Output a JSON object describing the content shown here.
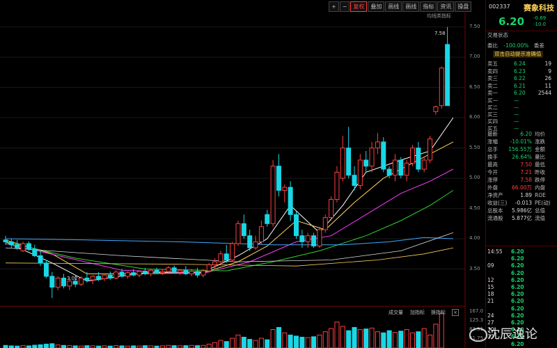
{
  "toolbar": {
    "items": [
      "+",
      "−",
      "复权",
      "叠加",
      "画线",
      "画线",
      "指标",
      "资讯",
      "操盘"
    ],
    "active_index": 2
  },
  "ma_label": "均线类指标",
  "price_axis": [
    "7.50",
    "7.00",
    "6.50",
    "6.00",
    "5.50",
    "5.00",
    "4.50",
    "4.00",
    "3.50"
  ],
  "volume_axis": [
    "167.0",
    "125.3",
    "83.51",
    "41.75"
  ],
  "high_label": "7.58",
  "low_label": "3.02",
  "volume_buttons": [
    "成交量",
    "加指标",
    "换指标"
  ],
  "stock": {
    "code": "002337",
    "name": "赛象科技",
    "price": "6.20",
    "change": "-0.69",
    "change_pct": "-10.0"
  },
  "section_title": "交易状态",
  "commission": {
    "label": "委比",
    "value": "-100.00%",
    "label2": "委差"
  },
  "tip": "双击自动提示准确值",
  "sell": [
    {
      "label": "卖五",
      "price": "6.24",
      "vol": "19"
    },
    {
      "label": "卖四",
      "price": "6.23",
      "vol": "9"
    },
    {
      "label": "卖三",
      "price": "6.22",
      "vol": "26"
    },
    {
      "label": "卖二",
      "price": "6.21",
      "vol": "11"
    },
    {
      "label": "卖一",
      "price": "6.20",
      "vol": "2544"
    }
  ],
  "buy": [
    {
      "label": "买一",
      "price": "—",
      "vol": ""
    },
    {
      "label": "买二",
      "price": "—",
      "vol": ""
    },
    {
      "label": "买三",
      "price": "—",
      "vol": ""
    },
    {
      "label": "买四",
      "price": "—",
      "vol": ""
    },
    {
      "label": "买五",
      "price": "—",
      "vol": ""
    }
  ],
  "quote": [
    {
      "l1": "最新",
      "v1": "6.20",
      "l2": "均价"
    },
    {
      "l1": "涨幅",
      "v1": "-10.01%",
      "l2": "涨跌"
    },
    {
      "l1": "总手",
      "v1": "156.55万",
      "l2": "金额"
    },
    {
      "l1": "换手",
      "v1": "26.64%",
      "l2": "量比"
    },
    {
      "l1": "最高",
      "v1": "7.50",
      "l2": "最低"
    },
    {
      "l1": "今开",
      "v1": "7.21",
      "l2": "昨收"
    },
    {
      "l1": "涨停",
      "v1": "7.58",
      "l2": "跌停"
    },
    {
      "l1": "外盘",
      "v1": "66.00万",
      "l2": "内盘"
    },
    {
      "l1": "净资产",
      "v1": "1.89",
      "l2": "ROE"
    },
    {
      "l1": "收益(三)",
      "v1": "-0.013",
      "l2": "PE(动)"
    },
    {
      "l1": "总股本",
      "v1": "5.986亿",
      "l2": "总值"
    },
    {
      "l1": "流通股",
      "v1": "5.877亿",
      "l2": "流值"
    }
  ],
  "ticks": [
    {
      "time": "14:55",
      "price": "6.20"
    },
    {
      "time": "",
      "price": "6.20"
    },
    {
      "time": "09",
      "price": "6.20"
    },
    {
      "time": "",
      "price": "6.20"
    },
    {
      "time": "12",
      "price": "6.20"
    },
    {
      "time": "15",
      "price": "6.20"
    },
    {
      "time": "18",
      "price": "6.20"
    },
    {
      "time": "21",
      "price": "6.20"
    },
    {
      "time": "",
      "price": "6.20"
    },
    {
      "time": "24",
      "price": "6.20"
    },
    {
      "time": "27",
      "price": "6.20"
    },
    {
      "time": "30",
      "price": "6.20"
    },
    {
      "time": "33",
      "price": "6.20"
    },
    {
      "time": "",
      "price": "6.20"
    }
  ],
  "watermark": "沈辰逸论",
  "colors": {
    "up": "#ff4040",
    "down": "#19d7e6",
    "bg": "#000000",
    "ma5": "#ffffff",
    "ma10": "#ffd35a",
    "ma20": "#ff3cff",
    "ma30": "#2fd32f",
    "ma60": "#3fa9ff"
  },
  "chart_data": {
    "type": "candlestick",
    "ylim": [
      3.0,
      7.6
    ],
    "candles": [
      {
        "o": 3.98,
        "h": 4.05,
        "l": 3.9,
        "c": 3.95
      },
      {
        "o": 3.95,
        "h": 4.0,
        "l": 3.85,
        "c": 3.9
      },
      {
        "o": 3.9,
        "h": 3.98,
        "l": 3.82,
        "c": 3.85
      },
      {
        "o": 3.8,
        "h": 3.95,
        "l": 3.78,
        "c": 3.92
      },
      {
        "o": 3.92,
        "h": 3.96,
        "l": 3.8,
        "c": 3.83
      },
      {
        "o": 3.83,
        "h": 3.9,
        "l": 3.7,
        "c": 3.72
      },
      {
        "o": 3.72,
        "h": 3.8,
        "l": 3.55,
        "c": 3.6
      },
      {
        "o": 3.6,
        "h": 3.65,
        "l": 3.35,
        "c": 3.38
      },
      {
        "o": 3.38,
        "h": 3.45,
        "l": 3.02,
        "c": 3.2
      },
      {
        "o": 3.2,
        "h": 3.38,
        "l": 3.15,
        "c": 3.35
      },
      {
        "o": 3.35,
        "h": 3.42,
        "l": 3.18,
        "c": 3.22
      },
      {
        "o": 3.22,
        "h": 3.35,
        "l": 3.15,
        "c": 3.3
      },
      {
        "o": 3.3,
        "h": 3.4,
        "l": 3.2,
        "c": 3.25
      },
      {
        "o": 3.25,
        "h": 3.38,
        "l": 3.22,
        "c": 3.35
      },
      {
        "o": 3.35,
        "h": 3.45,
        "l": 3.28,
        "c": 3.32
      },
      {
        "o": 3.32,
        "h": 3.4,
        "l": 3.25,
        "c": 3.38
      },
      {
        "o": 3.38,
        "h": 3.45,
        "l": 3.3,
        "c": 3.34
      },
      {
        "o": 3.34,
        "h": 3.42,
        "l": 3.3,
        "c": 3.4
      },
      {
        "o": 3.4,
        "h": 3.46,
        "l": 3.32,
        "c": 3.35
      },
      {
        "o": 3.35,
        "h": 3.48,
        "l": 3.33,
        "c": 3.45
      },
      {
        "o": 3.45,
        "h": 3.5,
        "l": 3.36,
        "c": 3.38
      },
      {
        "o": 3.38,
        "h": 3.46,
        "l": 3.34,
        "c": 3.44
      },
      {
        "o": 3.44,
        "h": 3.5,
        "l": 3.38,
        "c": 3.4
      },
      {
        "o": 3.4,
        "h": 3.48,
        "l": 3.36,
        "c": 3.46
      },
      {
        "o": 3.46,
        "h": 3.52,
        "l": 3.4,
        "c": 3.42
      },
      {
        "o": 3.42,
        "h": 3.5,
        "l": 3.38,
        "c": 3.48
      },
      {
        "o": 3.48,
        "h": 3.52,
        "l": 3.42,
        "c": 3.44
      },
      {
        "o": 3.44,
        "h": 3.5,
        "l": 3.4,
        "c": 3.46
      },
      {
        "o": 3.46,
        "h": 3.55,
        "l": 3.44,
        "c": 3.52
      },
      {
        "o": 3.52,
        "h": 3.56,
        "l": 3.42,
        "c": 3.45
      },
      {
        "o": 3.45,
        "h": 3.5,
        "l": 3.4,
        "c": 3.48
      },
      {
        "o": 3.48,
        "h": 3.55,
        "l": 3.4,
        "c": 3.42
      },
      {
        "o": 3.42,
        "h": 3.5,
        "l": 3.38,
        "c": 3.46
      },
      {
        "o": 3.46,
        "h": 3.52,
        "l": 3.36,
        "c": 3.4
      },
      {
        "o": 3.4,
        "h": 3.5,
        "l": 3.36,
        "c": 3.47
      },
      {
        "o": 3.47,
        "h": 3.6,
        "l": 3.44,
        "c": 3.57
      },
      {
        "o": 3.57,
        "h": 3.68,
        "l": 3.5,
        "c": 3.62
      },
      {
        "o": 3.62,
        "h": 3.8,
        "l": 3.58,
        "c": 3.75
      },
      {
        "o": 3.75,
        "h": 3.9,
        "l": 3.6,
        "c": 3.65
      },
      {
        "o": 3.65,
        "h": 3.95,
        "l": 3.62,
        "c": 3.92
      },
      {
        "o": 3.92,
        "h": 4.3,
        "l": 3.88,
        "c": 4.25
      },
      {
        "o": 4.25,
        "h": 4.4,
        "l": 4.0,
        "c": 4.05
      },
      {
        "o": 4.05,
        "h": 4.15,
        "l": 3.8,
        "c": 3.85
      },
      {
        "o": 3.85,
        "h": 4.05,
        "l": 3.82,
        "c": 3.95
      },
      {
        "o": 3.95,
        "h": 4.3,
        "l": 3.9,
        "c": 4.2
      },
      {
        "o": 4.4,
        "h": 4.48,
        "l": 4.2,
        "c": 4.25
      },
      {
        "o": 4.25,
        "h": 5.3,
        "l": 4.2,
        "c": 5.2
      },
      {
        "o": 5.2,
        "h": 5.4,
        "l": 4.7,
        "c": 4.8
      },
      {
        "o": 4.8,
        "h": 4.9,
        "l": 4.6,
        "c": 4.85
      },
      {
        "o": 4.85,
        "h": 4.95,
        "l": 4.3,
        "c": 4.4
      },
      {
        "o": 4.4,
        "h": 4.45,
        "l": 4.0,
        "c": 4.05
      },
      {
        "o": 4.05,
        "h": 4.15,
        "l": 3.85,
        "c": 3.95
      },
      {
        "o": 3.95,
        "h": 4.1,
        "l": 3.85,
        "c": 4.05
      },
      {
        "o": 4.05,
        "h": 4.1,
        "l": 3.85,
        "c": 3.88
      },
      {
        "o": 3.88,
        "h": 4.2,
        "l": 3.85,
        "c": 4.15
      },
      {
        "o": 4.15,
        "h": 4.4,
        "l": 4.1,
        "c": 4.35
      },
      {
        "o": 4.35,
        "h": 4.7,
        "l": 4.3,
        "c": 4.65
      },
      {
        "o": 4.65,
        "h": 5.2,
        "l": 4.6,
        "c": 5.1
      },
      {
        "o": 5.0,
        "h": 5.7,
        "l": 4.95,
        "c": 5.5
      },
      {
        "o": 5.5,
        "h": 5.85,
        "l": 5.0,
        "c": 5.05
      },
      {
        "o": 5.05,
        "h": 5.2,
        "l": 4.8,
        "c": 4.88
      },
      {
        "o": 4.88,
        "h": 5.4,
        "l": 4.82,
        "c": 5.3
      },
      {
        "o": 5.3,
        "h": 5.45,
        "l": 5.1,
        "c": 5.2
      },
      {
        "o": 5.2,
        "h": 5.6,
        "l": 5.1,
        "c": 5.5
      },
      {
        "o": 5.5,
        "h": 5.75,
        "l": 5.4,
        "c": 5.6
      },
      {
        "o": 5.6,
        "h": 5.68,
        "l": 5.1,
        "c": 5.15
      },
      {
        "o": 5.15,
        "h": 5.2,
        "l": 5.0,
        "c": 5.05
      },
      {
        "o": 5.05,
        "h": 5.4,
        "l": 4.95,
        "c": 5.3
      },
      {
        "o": 5.3,
        "h": 5.35,
        "l": 5.0,
        "c": 5.05
      },
      {
        "o": 5.05,
        "h": 5.3,
        "l": 4.95,
        "c": 5.25
      },
      {
        "o": 5.25,
        "h": 5.55,
        "l": 5.2,
        "c": 5.5
      },
      {
        "o": 5.5,
        "h": 5.6,
        "l": 5.1,
        "c": 5.15
      },
      {
        "o": 5.15,
        "h": 5.35,
        "l": 5.1,
        "c": 5.3
      },
      {
        "o": 5.3,
        "h": 5.7,
        "l": 5.25,
        "c": 5.65
      },
      {
        "o": 6.1,
        "h": 6.2,
        "l": 6.05,
        "c": 6.18
      },
      {
        "o": 6.2,
        "h": 6.85,
        "l": 6.15,
        "c": 6.82
      },
      {
        "o": 7.21,
        "h": 7.5,
        "l": 6.2,
        "c": 6.2
      }
    ],
    "volumes": [
      12,
      10,
      9,
      11,
      10,
      13,
      15,
      18,
      20,
      14,
      12,
      11,
      10,
      9,
      11,
      10,
      9,
      10,
      9,
      11,
      10,
      9,
      10,
      9,
      11,
      10,
      9,
      10,
      12,
      11,
      10,
      11,
      12,
      11,
      12,
      18,
      25,
      35,
      30,
      45,
      60,
      50,
      40,
      35,
      45,
      38,
      85,
      95,
      70,
      60,
      55,
      50,
      48,
      52,
      60,
      75,
      90,
      120,
      100,
      80,
      95,
      85,
      88,
      92,
      75,
      70,
      80,
      72,
      78,
      85,
      70,
      75,
      90,
      60,
      110,
      160
    ],
    "ma": {
      "ma5": [
        [
          0,
          3.95
        ],
        [
          8,
          3.6
        ],
        [
          14,
          3.3
        ],
        [
          24,
          3.44
        ],
        [
          34,
          3.45
        ],
        [
          40,
          3.72
        ],
        [
          45,
          4.0
        ],
        [
          49,
          4.55
        ],
        [
          54,
          4.1
        ],
        [
          58,
          4.55
        ],
        [
          62,
          5.1
        ],
        [
          68,
          5.3
        ],
        [
          73,
          5.45
        ],
        [
          77,
          6.0
        ]
      ],
      "ma10": [
        [
          0,
          3.98
        ],
        [
          8,
          3.75
        ],
        [
          14,
          3.42
        ],
        [
          24,
          3.42
        ],
        [
          34,
          3.44
        ],
        [
          40,
          3.62
        ],
        [
          45,
          3.88
        ],
        [
          50,
          4.3
        ],
        [
          55,
          4.15
        ],
        [
          60,
          4.6
        ],
        [
          65,
          5.0
        ],
        [
          70,
          5.25
        ],
        [
          77,
          5.6
        ]
      ],
      "ma20": [
        [
          0,
          3.92
        ],
        [
          10,
          3.7
        ],
        [
          20,
          3.48
        ],
        [
          34,
          3.43
        ],
        [
          42,
          3.62
        ],
        [
          50,
          3.95
        ],
        [
          56,
          4.05
        ],
        [
          62,
          4.4
        ],
        [
          68,
          4.75
        ],
        [
          73,
          4.95
        ],
        [
          77,
          5.15
        ]
      ],
      "ma30": [
        [
          0,
          3.95
        ],
        [
          12,
          3.68
        ],
        [
          24,
          3.5
        ],
        [
          38,
          3.47
        ],
        [
          46,
          3.62
        ],
        [
          54,
          3.8
        ],
        [
          62,
          4.05
        ],
        [
          68,
          4.3
        ],
        [
          73,
          4.55
        ],
        [
          77,
          4.8
        ]
      ],
      "ma60": [
        [
          0,
          4.0
        ],
        [
          14,
          3.98
        ],
        [
          30,
          3.95
        ],
        [
          46,
          3.9
        ],
        [
          58,
          3.9
        ],
        [
          66,
          3.95
        ],
        [
          72,
          4.02
        ],
        [
          77,
          4.0
        ]
      ],
      "ma120": [
        [
          0,
          3.85
        ],
        [
          20,
          3.72
        ],
        [
          40,
          3.62
        ],
        [
          56,
          3.65
        ],
        [
          68,
          3.8
        ],
        [
          77,
          4.1
        ]
      ],
      "ma250": [
        [
          0,
          3.6
        ],
        [
          30,
          3.58
        ],
        [
          50,
          3.55
        ],
        [
          64,
          3.65
        ],
        [
          72,
          3.75
        ],
        [
          77,
          3.85
        ]
      ]
    }
  }
}
